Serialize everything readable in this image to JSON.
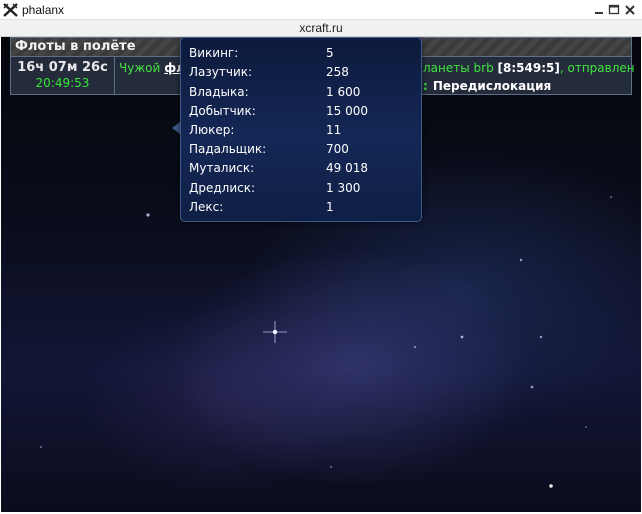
{
  "window": {
    "title": "phalanx",
    "url": "xcraft.ru",
    "icons": {
      "app": "crossed-swords-icon",
      "minimize": "minimize-icon",
      "maximize": "maximize-icon",
      "close": "close-icon"
    }
  },
  "fleets_panel": {
    "header": "Флоты в полёте",
    "rows": [
      {
        "time_remaining": "16ч 07м 26с",
        "arrival_time": "20:49:53",
        "owner_prefix": "Чужой",
        "fleet_link": "фл",
        "planet_prefix": "ланеты brb",
        "coords": "[8:549:5]",
        "sent_text": ", отправлен",
        "mission_colon": ":",
        "mission": "Передислокация"
      }
    ]
  },
  "fleet_tooltip": {
    "ships": [
      {
        "name": "Викинг:",
        "count": "5"
      },
      {
        "name": "Лазутчик:",
        "count": "258"
      },
      {
        "name": "Владыка:",
        "count": "1 600"
      },
      {
        "name": "Добытчик:",
        "count": "15 000"
      },
      {
        "name": "Люкер:",
        "count": "11"
      },
      {
        "name": "Падальщик:",
        "count": "700"
      },
      {
        "name": "Муталиск:",
        "count": "49 018"
      },
      {
        "name": "Дредлиск:",
        "count": "1 300"
      },
      {
        "name": "Лекс:",
        "count": "1"
      }
    ]
  },
  "colors": {
    "accent_green": "#3fe33f",
    "arrival_green": "#36e336",
    "tooltip_bg": "#142755",
    "row_bg": "#242c3c"
  }
}
